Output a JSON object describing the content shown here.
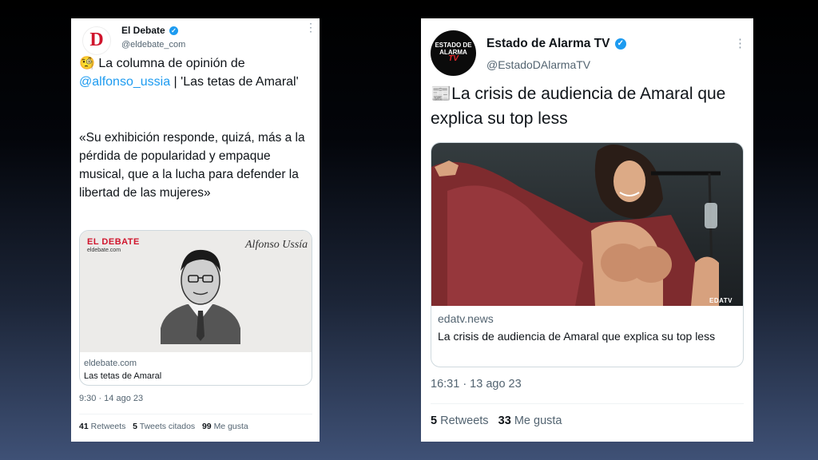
{
  "tweet1": {
    "name": "El Debate",
    "handle": "@eldebate_com",
    "avatar_letter": "D",
    "emoji": "🧐",
    "text_intro": "La columna de opinión de",
    "mention": "@alfonso_ussia",
    "text_after_mention": " | 'Las tetas de Amaral'",
    "quote": "«Su exhibición responde, quizá, más a la pérdida de popularidad y empaque musical, que a la lucha para defender la libertad de las mujeres»",
    "card_brand": "EL DEBATE",
    "card_brand_sub": "eldebate.com",
    "card_author": "Alfonso Ussía",
    "card_domain": "eldebate.com",
    "card_title": "Las tetas de Amaral",
    "timestamp": "9:30 · 14 ago 23",
    "retweets_count": "41",
    "retweets_label": "Retweets",
    "quotes_count": "5",
    "quotes_label": "Tweets citados",
    "likes_count": "99",
    "likes_label": "Me gusta"
  },
  "tweet2": {
    "name": "Estado de Alarma TV",
    "handle": "@EstadoDAlarmaTV",
    "avatar_line1": "ESTADO DE",
    "avatar_line2": "ALARMA",
    "avatar_line3": "TV",
    "emoji": "📰",
    "text": "La crisis de audiencia de Amaral que explica su top less",
    "image_watermark": "EDATV",
    "card_domain": "edatv.news",
    "card_title": "La crisis de audiencia de Amaral que explica su top less",
    "timestamp": "16:31 · 13 ago 23",
    "retweets_count": "5",
    "retweets_label": "Retweets",
    "likes_count": "33",
    "likes_label": "Me gusta"
  },
  "icons": {
    "verified": "verified-badge-icon",
    "more": "more-options-icon"
  },
  "colors": {
    "link": "#1d9bf0",
    "secondary_text": "#536471",
    "brand_red": "#d0142c"
  }
}
